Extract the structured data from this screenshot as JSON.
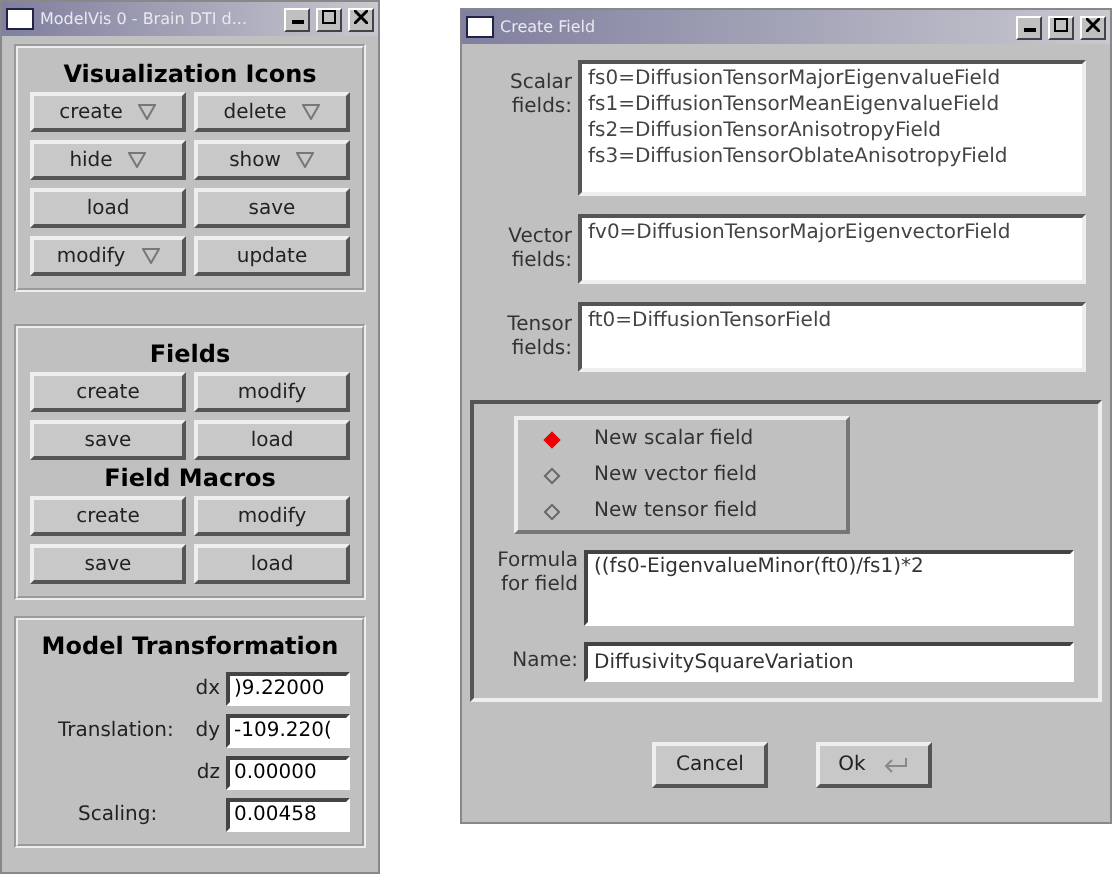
{
  "model_window": {
    "title": "ModelVis 0 - Brain DTI d...",
    "visualization_icons": {
      "title": "Visualization Icons",
      "buttons": [
        {
          "label": "create",
          "menu": true
        },
        {
          "label": "delete",
          "menu": true
        },
        {
          "label": "hide",
          "menu": true
        },
        {
          "label": "show",
          "menu": true
        },
        {
          "label": "load",
          "menu": false
        },
        {
          "label": "save",
          "menu": false
        },
        {
          "label": "modify",
          "menu": true
        },
        {
          "label": "update",
          "menu": false
        }
      ]
    },
    "fields": {
      "title": "Fields",
      "buttons": [
        "create",
        "modify",
        "save",
        "load"
      ]
    },
    "field_macros": {
      "title": "Field Macros",
      "buttons": [
        "create",
        "modify",
        "save",
        "load"
      ]
    },
    "model_transformation": {
      "title": "Model Transformation",
      "translation_label": "Translation:",
      "dx_label": "dx",
      "dx": ")9.22000",
      "dy_label": "dy",
      "dy": "-109.220(",
      "dz_label": "dz",
      "dz": "0.00000",
      "scaling_label": "Scaling:",
      "scaling": "0.00458"
    }
  },
  "create_field_window": {
    "title": "Create Field",
    "lists": [
      {
        "label": "Scalar fields:",
        "items": [
          "fs0=DiffusionTensorMajorEigenvalueField",
          "fs1=DiffusionTensorMeanEigenvalueField",
          "fs2=DiffusionTensorAnisotropyField",
          "fs3=DiffusionTensorOblateAnisotropyField"
        ]
      },
      {
        "label": "Vector fields:",
        "items": [
          "fv0=DiffusionTensorMajorEigenvectorField"
        ]
      },
      {
        "label": "Tensor fields:",
        "items": [
          "ft0=DiffusionTensorField"
        ]
      }
    ],
    "options": [
      {
        "label": "New scalar field",
        "selected": true
      },
      {
        "label": "New vector field",
        "selected": false
      },
      {
        "label": "New tensor field",
        "selected": false
      }
    ],
    "formula_label": "Formula for field",
    "formula": "((fs0-EigenvalueMinor(ft0)/fs1)*2",
    "name_label": "Name:",
    "name": "DiffusivitySquareVariation",
    "buttons": [
      "Cancel",
      "Ok"
    ]
  }
}
